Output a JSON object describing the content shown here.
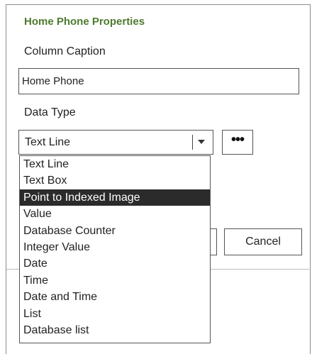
{
  "dialog": {
    "title": "Home Phone Properties",
    "caption_label": "Column Caption",
    "caption_value": "Home Phone",
    "data_type_label": "Data Type",
    "data_type_value": "Text Line",
    "more_button_label": "•••",
    "ok_button_label": "",
    "cancel_button_label": "Cancel"
  },
  "dropdown": {
    "selected_index": 2,
    "options": [
      "Text Line",
      "Text Box",
      "Point to Indexed Image",
      "Value",
      "Database Counter",
      "Integer Value",
      "Date",
      "Time",
      "Date and Time",
      "List",
      "Database list"
    ]
  },
  "colors": {
    "title": "#4d7a2e",
    "selected_bg": "#2b2b2b",
    "selected_text": "#ffffff"
  }
}
